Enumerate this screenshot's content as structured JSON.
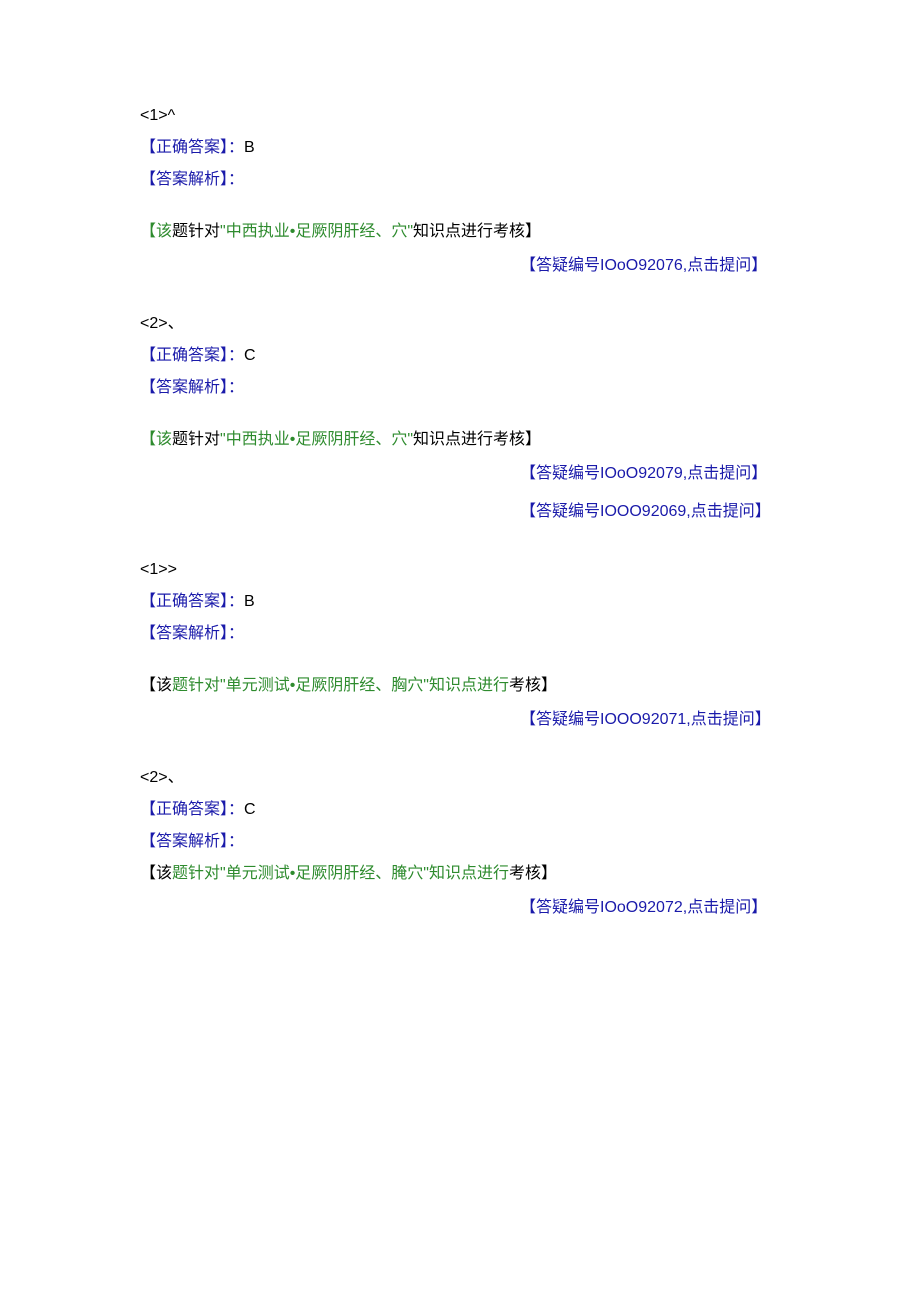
{
  "blocks": [
    {
      "num": "<1>^",
      "correct_label": "【正确答案】：",
      "correct_value": "B",
      "analysis_label": "【答案解析】：",
      "note_a": "【该",
      "note_b": "题针对",
      "note_c": "\"中西执业•足厥阴肝经、穴\"",
      "note_d": "知识点进行考核】",
      "ask_a": "【答疑编号",
      "ask_b": "IOoO92076,",
      "ask_c": "点击提问】"
    },
    {
      "num": "<2>、",
      "correct_label": "【正确答案】：",
      "correct_value": "C",
      "analysis_label": "【答案解析】：",
      "note_a": "【该",
      "note_b": "题针对",
      "note_c": "\"中西执业•足厥阴肝经、穴\"",
      "note_d": "知识点进行考核】",
      "ask_a": "【答疑编号",
      "ask_b": "IOoO92079,",
      "ask_c": "点击提问】"
    }
  ],
  "extra_ask": {
    "a": "【答疑编号",
    "b": "IOOO92069,",
    "c": "点击提问】"
  },
  "blocks2": [
    {
      "num": "<1>>",
      "correct_label": "【正确答案】：",
      "correct_value": "B",
      "analysis_label": "【答案解析】：",
      "note_a": "【该",
      "note_b": "题针对\"单元测试•足厥阴肝经、胸穴\"知识点进行",
      "note_c": "考核】",
      "ask_a": "【答疑编号",
      "ask_b": "IOOO92071,",
      "ask_c": "点击提问】"
    },
    {
      "num": "<2>、",
      "correct_label": "【正确答案】：",
      "correct_value": "C",
      "analysis_label": "【答案解析】：",
      "note_a": "【该",
      "note_b": "题针对\"单元测试•足厥阴肝经、腌穴\"知识点进行",
      "note_c": "考核】",
      "ask_a": "【答疑编号",
      "ask_b": "IOoO92072,",
      "ask_c": "点击提问】"
    }
  ]
}
